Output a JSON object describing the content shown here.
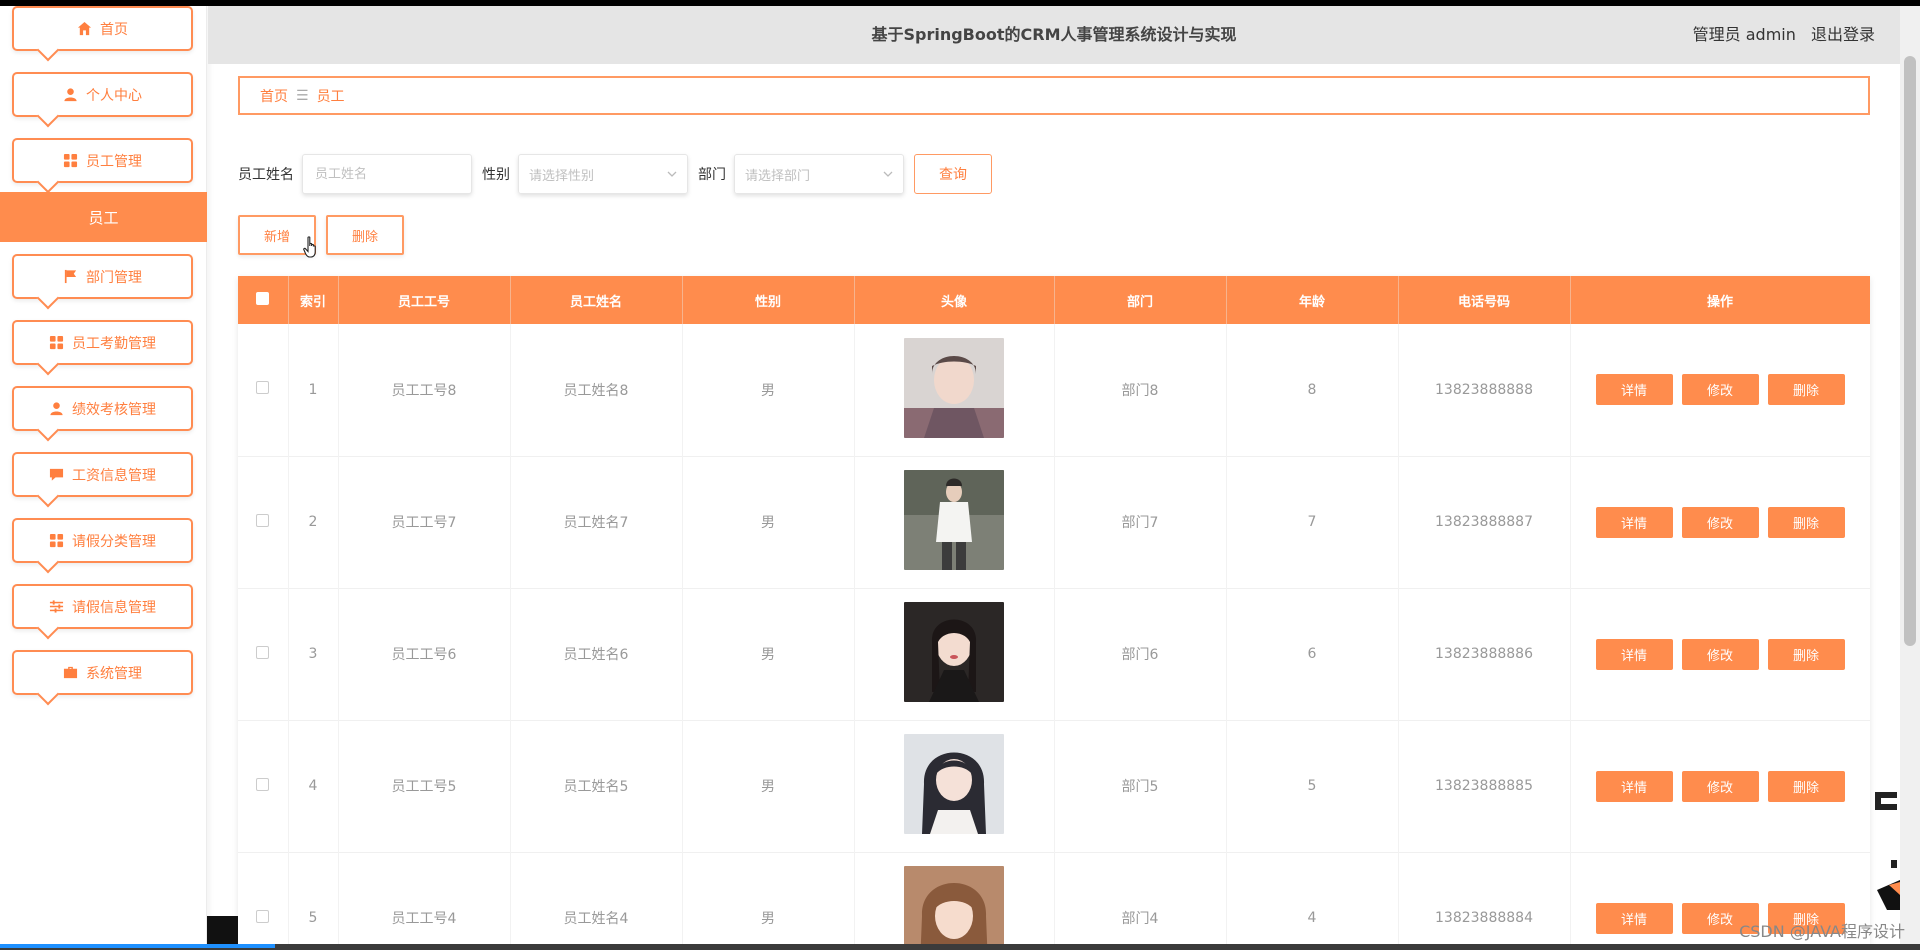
{
  "app": {
    "title": "基于SpringBoot的CRM人事管理系统设计与实现",
    "user": "管理员 admin",
    "logout": "退出登录"
  },
  "sidebar": {
    "items": [
      {
        "label": "首页",
        "icon": "home-icon"
      },
      {
        "label": "个人中心",
        "icon": "user-icon"
      },
      {
        "label": "员工管理",
        "icon": "grid-icon"
      },
      {
        "label": "部门管理",
        "icon": "flag-icon"
      },
      {
        "label": "员工考勤管理",
        "icon": "grid-icon"
      },
      {
        "label": "绩效考核管理",
        "icon": "user-icon"
      },
      {
        "label": "工资信息管理",
        "icon": "chat-icon"
      },
      {
        "label": "请假分类管理",
        "icon": "grid-icon"
      },
      {
        "label": "请假信息管理",
        "icon": "sliders-icon"
      },
      {
        "label": "系统管理",
        "icon": "briefcase-icon"
      }
    ],
    "active_sub": "员工"
  },
  "breadcrumb": {
    "home": "首页",
    "separator": "☰",
    "current": "员工"
  },
  "search": {
    "name_label": "员工姓名",
    "name_placeholder": "员工姓名",
    "gender_label": "性别",
    "gender_placeholder": "请选择性别",
    "dept_label": "部门",
    "dept_placeholder": "请选择部门",
    "query": "查询"
  },
  "actions": {
    "add": "新增",
    "delete": "删除"
  },
  "table": {
    "headers": [
      "",
      "索引",
      "员工工号",
      "员工姓名",
      "性别",
      "头像",
      "部门",
      "年龄",
      "电话号码",
      "操作"
    ],
    "rows": [
      {
        "index": "1",
        "emp_no": "员工工号8",
        "name": "员工姓名8",
        "gender": "男",
        "dept": "部门8",
        "age": "8",
        "phone": "13823888888"
      },
      {
        "index": "2",
        "emp_no": "员工工号7",
        "name": "员工姓名7",
        "gender": "男",
        "dept": "部门7",
        "age": "7",
        "phone": "13823888887"
      },
      {
        "index": "3",
        "emp_no": "员工工号6",
        "name": "员工姓名6",
        "gender": "男",
        "dept": "部门6",
        "age": "6",
        "phone": "13823888886"
      },
      {
        "index": "4",
        "emp_no": "员工工号5",
        "name": "员工姓名5",
        "gender": "男",
        "dept": "部门5",
        "age": "5",
        "phone": "13823888885"
      },
      {
        "index": "5",
        "emp_no": "员工工号4",
        "name": "员工姓名4",
        "gender": "男",
        "dept": "部门4",
        "age": "4",
        "phone": "13823888884"
      }
    ],
    "op": {
      "detail": "详情",
      "edit": "修改",
      "delete": "删除"
    }
  },
  "watermark": "CSDN @JAVA程序设计",
  "colors": {
    "accent": "#ff8c4d",
    "accent_text": "#ff7f3f",
    "header_bg": "#e5e5e5"
  }
}
